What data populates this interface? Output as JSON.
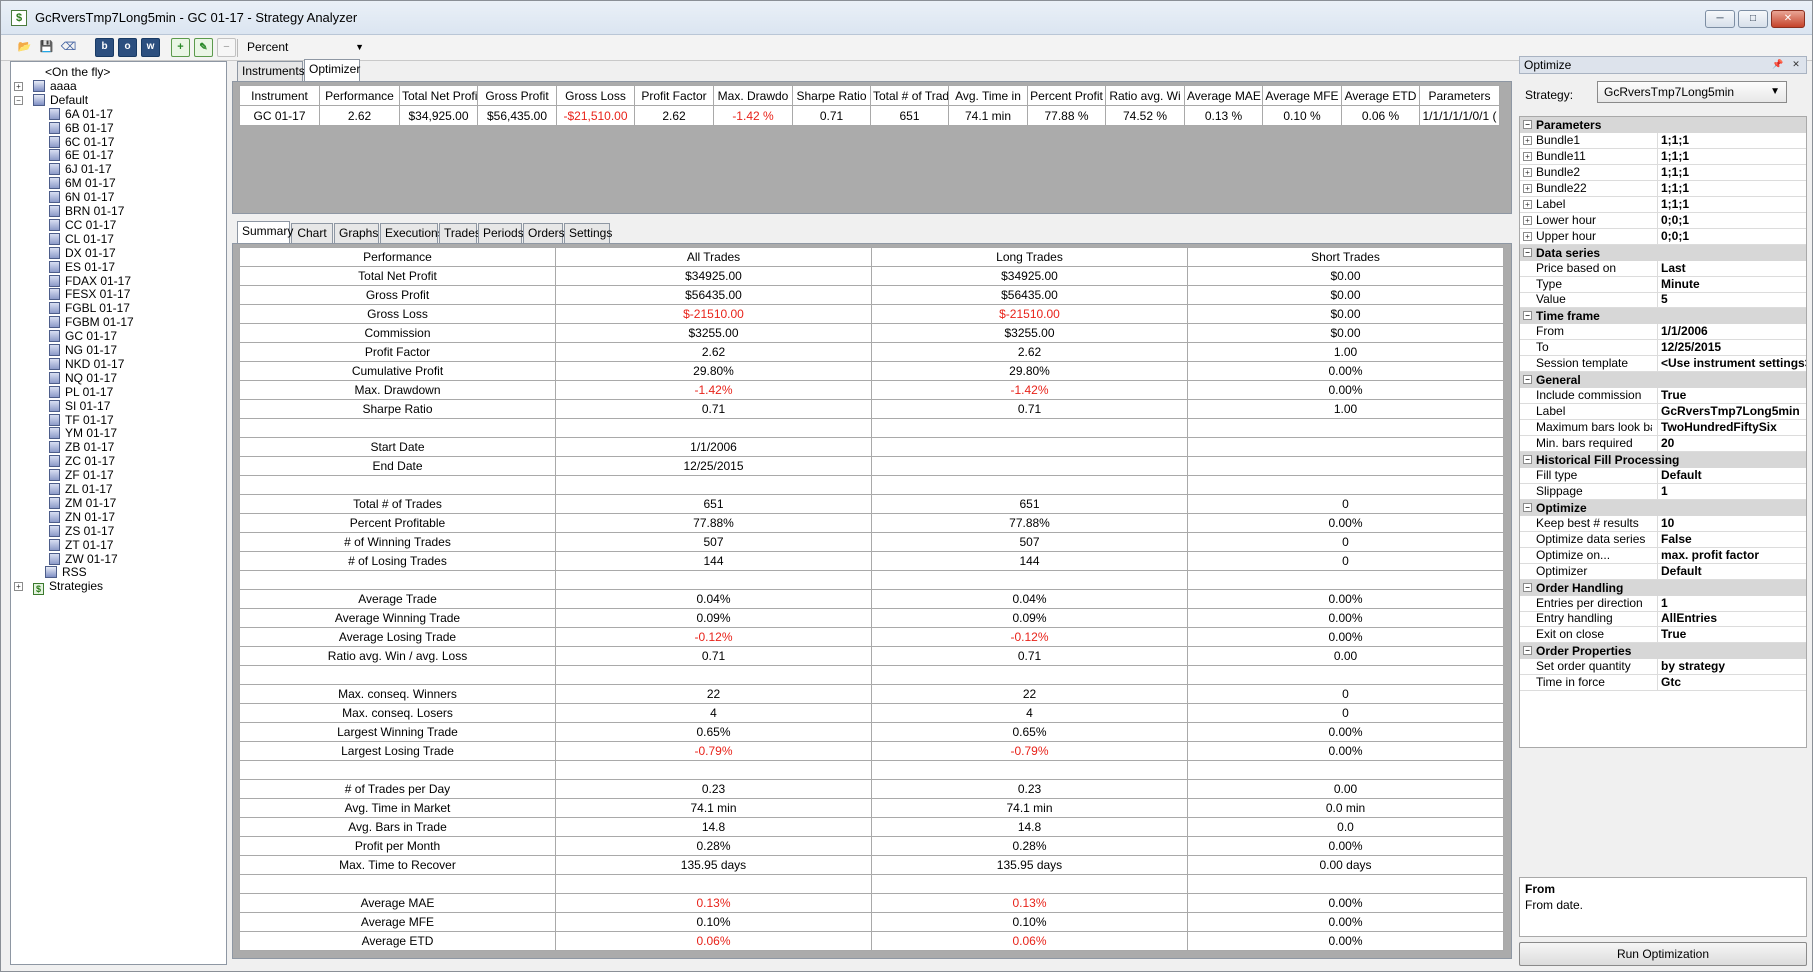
{
  "window": {
    "title": "GcRversTmp7Long5min - GC 01-17 - Strategy Analyzer"
  },
  "toolbar": {
    "performance_unit": "Percent"
  },
  "tree": [
    {
      "label": "<On the fly>",
      "level": 1,
      "icon": "none",
      "expander": ""
    },
    {
      "label": "aaaa",
      "level": 0,
      "icon": "group",
      "expander": "+"
    },
    {
      "label": "Default",
      "level": 0,
      "icon": "group",
      "expander": "-"
    },
    {
      "label": "6A 01-17",
      "level": 2,
      "icon": "instrument",
      "expander": ""
    },
    {
      "label": "6B 01-17",
      "level": 2,
      "icon": "instrument",
      "expander": ""
    },
    {
      "label": "6C 01-17",
      "level": 2,
      "icon": "instrument",
      "expander": ""
    },
    {
      "label": "6E 01-17",
      "level": 2,
      "icon": "instrument",
      "expander": ""
    },
    {
      "label": "6J 01-17",
      "level": 2,
      "icon": "instrument",
      "expander": ""
    },
    {
      "label": "6M 01-17",
      "level": 2,
      "icon": "instrument",
      "expander": ""
    },
    {
      "label": "6N 01-17",
      "level": 2,
      "icon": "instrument",
      "expander": ""
    },
    {
      "label": "BRN 01-17",
      "level": 2,
      "icon": "instrument",
      "expander": ""
    },
    {
      "label": "CC 01-17",
      "level": 2,
      "icon": "instrument",
      "expander": ""
    },
    {
      "label": "CL 01-17",
      "level": 2,
      "icon": "instrument",
      "expander": ""
    },
    {
      "label": "DX 01-17",
      "level": 2,
      "icon": "instrument",
      "expander": ""
    },
    {
      "label": "ES 01-17",
      "level": 2,
      "icon": "instrument",
      "expander": ""
    },
    {
      "label": "FDAX 01-17",
      "level": 2,
      "icon": "instrument",
      "expander": ""
    },
    {
      "label": "FESX 01-17",
      "level": 2,
      "icon": "instrument",
      "expander": ""
    },
    {
      "label": "FGBL 01-17",
      "level": 2,
      "icon": "instrument",
      "expander": ""
    },
    {
      "label": "FGBM 01-17",
      "level": 2,
      "icon": "instrument",
      "expander": ""
    },
    {
      "label": "GC 01-17",
      "level": 2,
      "icon": "instrument",
      "expander": ""
    },
    {
      "label": "NG 01-17",
      "level": 2,
      "icon": "instrument",
      "expander": ""
    },
    {
      "label": "NKD 01-17",
      "level": 2,
      "icon": "instrument",
      "expander": ""
    },
    {
      "label": "NQ 01-17",
      "level": 2,
      "icon": "instrument",
      "expander": ""
    },
    {
      "label": "PL 01-17",
      "level": 2,
      "icon": "instrument",
      "expander": ""
    },
    {
      "label": "SI 01-17",
      "level": 2,
      "icon": "instrument",
      "expander": ""
    },
    {
      "label": "TF 01-17",
      "level": 2,
      "icon": "instrument",
      "expander": ""
    },
    {
      "label": "YM 01-17",
      "level": 2,
      "icon": "instrument",
      "expander": ""
    },
    {
      "label": "ZB 01-17",
      "level": 2,
      "icon": "instrument",
      "expander": ""
    },
    {
      "label": "ZC 01-17",
      "level": 2,
      "icon": "instrument",
      "expander": ""
    },
    {
      "label": "ZF 01-17",
      "level": 2,
      "icon": "instrument",
      "expander": ""
    },
    {
      "label": "ZL 01-17",
      "level": 2,
      "icon": "instrument",
      "expander": ""
    },
    {
      "label": "ZM 01-17",
      "level": 2,
      "icon": "instrument",
      "expander": ""
    },
    {
      "label": "ZN 01-17",
      "level": 2,
      "icon": "instrument",
      "expander": ""
    },
    {
      "label": "ZS 01-17",
      "level": 2,
      "icon": "instrument",
      "expander": ""
    },
    {
      "label": "ZT 01-17",
      "level": 2,
      "icon": "instrument",
      "expander": ""
    },
    {
      "label": "ZW 01-17",
      "level": 2,
      "icon": "instrument",
      "expander": ""
    },
    {
      "label": "RSS",
      "level": 1,
      "icon": "group",
      "expander": ""
    },
    {
      "label": "Strategies",
      "level": 0,
      "icon": "strategy",
      "expander": "+"
    }
  ],
  "top_tabs": [
    "Instruments",
    "Optimizer"
  ],
  "top_tab_active": 1,
  "optimizer": {
    "columns": [
      "Instrument",
      "Performance",
      "Total Net Profi",
      "Gross Profit",
      "Gross Loss",
      "Profit Factor",
      "Max. Drawdo",
      "Sharpe Ratio",
      "Total # of Trad",
      "Avg. Time in",
      "Percent Profit",
      "Ratio avg. Wi",
      "Average MAE",
      "Average MFE",
      "Average ETD",
      "Parameters"
    ],
    "rows": [
      {
        "cells": [
          "GC 01-17",
          "2.62",
          "$34,925.00",
          "$56,435.00",
          "-$21,510.00",
          "2.62",
          "-1.42 %",
          "0.71",
          "651",
          "74.1 min",
          "77.88 %",
          "74.52 %",
          "0.13 %",
          "0.10 %",
          "0.06 %",
          "1/1/1/1/1/0/1 ("
        ],
        "red_cols": [
          4,
          6
        ]
      }
    ]
  },
  "summary_tabs": [
    "Summary",
    "Chart",
    "Graphs",
    "Executions",
    "Trades",
    "Periods",
    "Orders",
    "Settings"
  ],
  "summary_tab_active": 0,
  "summary": {
    "headers": [
      "Performance",
      "All Trades",
      "Long Trades",
      "Short Trades"
    ],
    "rows": [
      {
        "label": "Total Net Profit",
        "all": "$34925.00",
        "long": "$34925.00",
        "short": "$0.00",
        "red": false
      },
      {
        "label": "Gross Profit",
        "all": "$56435.00",
        "long": "$56435.00",
        "short": "$0.00",
        "red": false
      },
      {
        "label": "Gross Loss",
        "all": "$-21510.00",
        "long": "$-21510.00",
        "short": "$0.00",
        "red": true
      },
      {
        "label": "Commission",
        "all": "$3255.00",
        "long": "$3255.00",
        "short": "$0.00",
        "red": false
      },
      {
        "label": "Profit Factor",
        "all": "2.62",
        "long": "2.62",
        "short": "1.00",
        "red": false
      },
      {
        "label": "Cumulative Profit",
        "all": "29.80%",
        "long": "29.80%",
        "short": "0.00%",
        "red": false
      },
      {
        "label": "Max. Drawdown",
        "all": "-1.42%",
        "long": "-1.42%",
        "short": "0.00%",
        "red": true
      },
      {
        "label": "Sharpe Ratio",
        "all": "0.71",
        "long": "0.71",
        "short": "1.00",
        "red": false
      },
      {
        "label": "",
        "all": "",
        "long": "",
        "short": "",
        "red": false
      },
      {
        "label": "Start Date",
        "all": "1/1/2006",
        "long": "",
        "short": "",
        "red": false
      },
      {
        "label": "End Date",
        "all": "12/25/2015",
        "long": "",
        "short": "",
        "red": false
      },
      {
        "label": "",
        "all": "",
        "long": "",
        "short": "",
        "red": false
      },
      {
        "label": "Total # of Trades",
        "all": "651",
        "long": "651",
        "short": "0",
        "red": false
      },
      {
        "label": "Percent Profitable",
        "all": "77.88%",
        "long": "77.88%",
        "short": "0.00%",
        "red": false
      },
      {
        "label": "# of Winning Trades",
        "all": "507",
        "long": "507",
        "short": "0",
        "red": false
      },
      {
        "label": "# of Losing Trades",
        "all": "144",
        "long": "144",
        "short": "0",
        "red": false
      },
      {
        "label": "",
        "all": "",
        "long": "",
        "short": "",
        "red": false
      },
      {
        "label": "Average Trade",
        "all": "0.04%",
        "long": "0.04%",
        "short": "0.00%",
        "red": false
      },
      {
        "label": "Average Winning Trade",
        "all": "0.09%",
        "long": "0.09%",
        "short": "0.00%",
        "red": false
      },
      {
        "label": "Average Losing Trade",
        "all": "-0.12%",
        "long": "-0.12%",
        "short": "0.00%",
        "red": true
      },
      {
        "label": "Ratio avg. Win / avg. Loss",
        "all": "0.71",
        "long": "0.71",
        "short": "0.00",
        "red": false
      },
      {
        "label": "",
        "all": "",
        "long": "",
        "short": "",
        "red": false
      },
      {
        "label": "Max. conseq. Winners",
        "all": "22",
        "long": "22",
        "short": "0",
        "red": false
      },
      {
        "label": "Max. conseq. Losers",
        "all": "4",
        "long": "4",
        "short": "0",
        "red": false
      },
      {
        "label": "Largest Winning Trade",
        "all": "0.65%",
        "long": "0.65%",
        "short": "0.00%",
        "red": false
      },
      {
        "label": "Largest Losing Trade",
        "all": "-0.79%",
        "long": "-0.79%",
        "short": "0.00%",
        "red": true
      },
      {
        "label": "",
        "all": "",
        "long": "",
        "short": "",
        "red": false
      },
      {
        "label": "# of Trades per Day",
        "all": "0.23",
        "long": "0.23",
        "short": "0.00",
        "red": false
      },
      {
        "label": "Avg. Time in Market",
        "all": "74.1 min",
        "long": "74.1 min",
        "short": "0.0 min",
        "red": false
      },
      {
        "label": "Avg. Bars in Trade",
        "all": "14.8",
        "long": "14.8",
        "short": "0.0",
        "red": false
      },
      {
        "label": "Profit per Month",
        "all": "0.28%",
        "long": "0.28%",
        "short": "0.00%",
        "red": false
      },
      {
        "label": "Max. Time to Recover",
        "all": "135.95 days",
        "long": "135.95 days",
        "short": "0.00 days",
        "red": false
      },
      {
        "label": "",
        "all": "",
        "long": "",
        "short": "",
        "red": false
      },
      {
        "label": "Average MAE",
        "all": "0.13%",
        "long": "0.13%",
        "short": "0.00%",
        "red": true
      },
      {
        "label": "Average MFE",
        "all": "0.10%",
        "long": "0.10%",
        "short": "0.00%",
        "red": false
      },
      {
        "label": "Average ETD",
        "all": "0.06%",
        "long": "0.06%",
        "short": "0.00%",
        "red": true
      }
    ]
  },
  "optimize_panel": {
    "title": "Optimize",
    "strategy_label": "Strategy:",
    "strategy_value": "GcRversTmp7Long5min",
    "categories": [
      {
        "name": "Parameters",
        "props": [
          {
            "name": "Bundle1",
            "value": "1;1;1",
            "expandable": true
          },
          {
            "name": "Bundle11",
            "value": "1;1;1",
            "expandable": true
          },
          {
            "name": "Bundle2",
            "value": "1;1;1",
            "expandable": true
          },
          {
            "name": "Bundle22",
            "value": "1;1;1",
            "expandable": true
          },
          {
            "name": "Label",
            "value": "1;1;1",
            "expandable": true
          },
          {
            "name": "Lower hour",
            "value": "0;0;1",
            "expandable": true
          },
          {
            "name": "Upper hour",
            "value": "0;0;1",
            "expandable": true
          }
        ]
      },
      {
        "name": "Data series",
        "props": [
          {
            "name": "Price based on",
            "value": "Last",
            "expandable": false
          },
          {
            "name": "Type",
            "value": "Minute",
            "expandable": false
          },
          {
            "name": "Value",
            "value": "5",
            "expandable": false
          }
        ]
      },
      {
        "name": "Time frame",
        "props": [
          {
            "name": "From",
            "value": "1/1/2006",
            "expandable": false
          },
          {
            "name": "To",
            "value": "12/25/2015",
            "expandable": false
          },
          {
            "name": "Session template",
            "value": "<Use instrument settings>",
            "expandable": false
          }
        ]
      },
      {
        "name": "General",
        "props": [
          {
            "name": "Include commission",
            "value": "True",
            "expandable": false
          },
          {
            "name": "Label",
            "value": "GcRversTmp7Long5min",
            "expandable": false
          },
          {
            "name": "Maximum bars look bac",
            "value": "TwoHundredFiftySix",
            "expandable": false
          },
          {
            "name": "Min. bars required",
            "value": "20",
            "expandable": false
          }
        ]
      },
      {
        "name": "Historical Fill Processing",
        "props": [
          {
            "name": "Fill type",
            "value": "Default",
            "expandable": false
          },
          {
            "name": "Slippage",
            "value": "1",
            "expandable": false
          }
        ]
      },
      {
        "name": "Optimize",
        "props": [
          {
            "name": "Keep best # results",
            "value": "10",
            "expandable": false
          },
          {
            "name": "Optimize data series",
            "value": "False",
            "expandable": false
          },
          {
            "name": "Optimize on...",
            "value": "max. profit factor",
            "expandable": false
          },
          {
            "name": "Optimizer",
            "value": "Default",
            "expandable": false
          }
        ]
      },
      {
        "name": "Order Handling",
        "props": [
          {
            "name": "Entries per direction",
            "value": "1",
            "expandable": false
          },
          {
            "name": "Entry handling",
            "value": "AllEntries",
            "expandable": false
          },
          {
            "name": "Exit on close",
            "value": "True",
            "expandable": false
          }
        ]
      },
      {
        "name": "Order Properties",
        "props": [
          {
            "name": "Set order quantity",
            "value": "by strategy",
            "expandable": false
          },
          {
            "name": "Time in force",
            "value": "Gtc",
            "expandable": false
          }
        ]
      }
    ],
    "help_title": "From",
    "help_desc": "From date.",
    "run_button": "Run Optimization"
  },
  "colors": {
    "negative": "#e8231a",
    "category_bg": "#d7d7d7",
    "grid_bg": "#ababab"
  }
}
